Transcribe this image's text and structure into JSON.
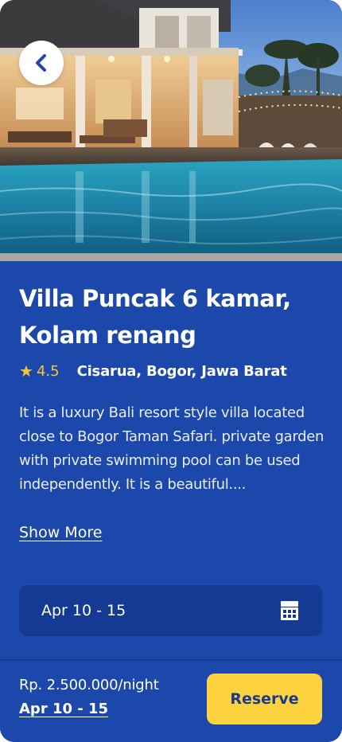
{
  "listing": {
    "title": "Villa Puncak 6 kamar, Kolam renang",
    "rating": "4.5",
    "location": "Cisarua, Bogor, Jawa Barat",
    "description": "It is a luxury Bali resort style villa located close to Bogor Taman Safari. private garden with  private swimming pool can be used independently. It is a beautiful....",
    "show_more_label": "Show More"
  },
  "date_picker": {
    "value": "Apr 10 - 15",
    "icon": "calendar-icon"
  },
  "bottom_bar": {
    "price": "Rp. 2.500.000/night",
    "dates": "Apr 10 - 15",
    "reserve_label": "Reserve"
  },
  "icons": {
    "back": "chevron-left-icon",
    "rating": "star-icon"
  },
  "colors": {
    "primary": "#1c47ab",
    "accent": "#fcd33f",
    "rating": "#f7c531"
  }
}
